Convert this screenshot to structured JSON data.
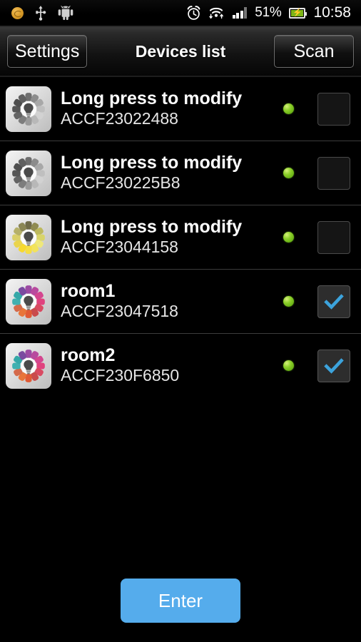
{
  "status_bar": {
    "icons_left": [
      "sync-icon",
      "usb-icon",
      "android-icon"
    ],
    "icons_right": [
      "alarm-icon",
      "wifi-icon",
      "signal-icon",
      "battery-charging-icon"
    ],
    "battery_percent": "51%",
    "clock": "10:58"
  },
  "action_bar": {
    "settings_label": "Settings",
    "title": "Devices list",
    "scan_label": "Scan"
  },
  "devices": [
    {
      "name": "Long press to modify",
      "mac": "ACCF23022488",
      "online": true,
      "checked": false,
      "icon": "color-wheel-bulb-icon",
      "wheel_colors": [
        "#6e6e6e",
        "#8c8c8c",
        "#a8a8a8",
        "#bfbfbf",
        "#d2d2d2",
        "#b8b8b8",
        "#9a9a9a",
        "#7d7d7d",
        "#636363",
        "#555555",
        "#4d4d4d",
        "#5f5f5f"
      ]
    },
    {
      "name": "Long press to modify",
      "mac": "ACCF230225B8",
      "online": true,
      "checked": false,
      "icon": "color-wheel-bulb-icon",
      "wheel_colors": [
        "#6e6e6e",
        "#8c8c8c",
        "#a8a8a8",
        "#bfbfbf",
        "#d2d2d2",
        "#b8b8b8",
        "#9a9a9a",
        "#7d7d7d",
        "#636363",
        "#555555",
        "#4d4d4d",
        "#5f5f5f"
      ]
    },
    {
      "name": "Long press to modify",
      "mac": "ACCF23044158",
      "online": true,
      "checked": false,
      "icon": "color-wheel-bulb-icon",
      "wheel_colors": [
        "#6e6a48",
        "#8f8b52",
        "#bdb95e",
        "#d8d46a",
        "#efe87a",
        "#f2e35c",
        "#f5de45",
        "#f7d92e",
        "#ead44c",
        "#d9cf6a",
        "#b5b06a",
        "#8a8655"
      ]
    },
    {
      "name": "room1",
      "mac": "ACCF23047518",
      "online": true,
      "checked": true,
      "icon": "color-wheel-bulb-icon",
      "wheel_colors": [
        "#9c4aa3",
        "#b84a9e",
        "#d4468f",
        "#e0427e",
        "#d94a62",
        "#c94a4c",
        "#e05a35",
        "#e8753a",
        "#d46a4a",
        "#3fb0b0",
        "#35a8a8",
        "#7a4aa0"
      ]
    },
    {
      "name": "room2",
      "mac": "ACCF230F6850",
      "online": true,
      "checked": true,
      "icon": "color-wheel-bulb-icon",
      "wheel_colors": [
        "#9c4aa3",
        "#b84a9e",
        "#d4468f",
        "#e0427e",
        "#d94a62",
        "#c94a4c",
        "#e05a35",
        "#e8753a",
        "#d46a4a",
        "#3fb0b0",
        "#35a8a8",
        "#7a4aa0"
      ]
    }
  ],
  "footer": {
    "enter_label": "Enter"
  },
  "colors": {
    "accent_blue": "#55ACEC",
    "online_green": "#8ccf2a",
    "check_blue": "#3CA3DC"
  }
}
